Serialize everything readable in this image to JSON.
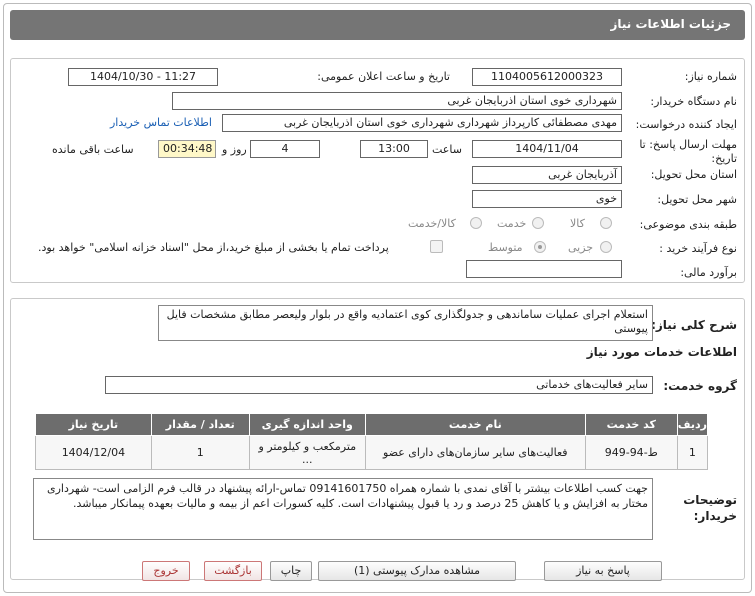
{
  "header": {
    "title": "جزئیات اطلاعات نیاز"
  },
  "fields": {
    "need_number_label": "شماره نیاز:",
    "need_number": "1104005612000323",
    "announce_label": "تاریخ و ساعت اعلان عمومی:",
    "announce_value": "1404/10/30 - 11:27",
    "buyer_org_label": "نام دستگاه خریدار:",
    "buyer_org": "شهرداری خوی استان اذربایجان غربی",
    "creator_label": "ایجاد کننده درخواست:",
    "creator": "مهدی مصطفائی کارپرداز شهرداری شهرداری خوی استان اذربایجان غربی",
    "buyer_contact_link": "اطلاعات تماس خریدار",
    "deadline_label": "مهلت ارسال پاسخ: تا تاریخ:",
    "deadline_date": "1404/11/04",
    "time_label": "ساعت",
    "deadline_time": "13:00",
    "days_value": "4",
    "days_label": "روز و",
    "remaining_time": "00:34:48",
    "remaining_label": "ساعت باقی مانده",
    "province_label": "استان محل تحویل:",
    "province": "آذربایجان غربی",
    "city_label": "شهر محل تحویل:",
    "city": "خوی",
    "category_label": "طبقه بندی موضوعی:",
    "category_options": [
      "کالا",
      "خدمت",
      "کالا/خدمت"
    ],
    "process_label": "نوع فرآیند خرید :",
    "process_options": [
      "جزیی",
      "متوسط"
    ],
    "payment_note": "پرداخت تمام یا بخشی از مبلغ خرید،از محل \"اسناد خزانه اسلامی\" خواهد بود.",
    "estimate_label": "برآورد مالی:",
    "estimate_value": ""
  },
  "description": {
    "label": "شرح کلی نیاز:",
    "text": "استعلام اجرای عملیات ساماندهی و جدولگذاری کوی اعتمادیه واقع در بلوار ولیعصر مطابق مشخصات فایل پیوستی"
  },
  "services": {
    "section_title": "اطلاعات خدمات مورد نیاز",
    "group_label": "گروه خدمت:",
    "group_value": "سایر فعالیت‌های خدماتی",
    "columns": [
      "ردیف",
      "کد خدمت",
      "نام خدمت",
      "واحد اندازه گیری",
      "تعداد / مقدار",
      "تاریخ نیاز"
    ],
    "rows": [
      {
        "row": "1",
        "code": "ط-94-949",
        "name": "فعالیت‌های سایر سازمان‌های دارای عضو",
        "unit": "مترمکعب و کیلومتر و ...",
        "qty": "1",
        "date": "1404/12/04"
      }
    ]
  },
  "buyer_notes": {
    "label": "توضیحات خریدار:",
    "text": "جهت کسب اطلاعات بیشتر با آقای نمدی با شماره همراه 09141601750 تماس-ارائه پیشنهاد در قالب فرم الزامی است- شهرداری مختار به افزایش و یا کاهش 25 درصد و رد یا قبول پیشنهادات است. کلیه کسورات اعم از بیمه و مالیات بعهده پیمانکار میباشد."
  },
  "buttons": {
    "reply": "پاسخ به نیاز",
    "attachments": "مشاهده مدارک پیوستی (1)",
    "print": "چاپ",
    "back": "بازگشت",
    "exit": "خروج"
  }
}
